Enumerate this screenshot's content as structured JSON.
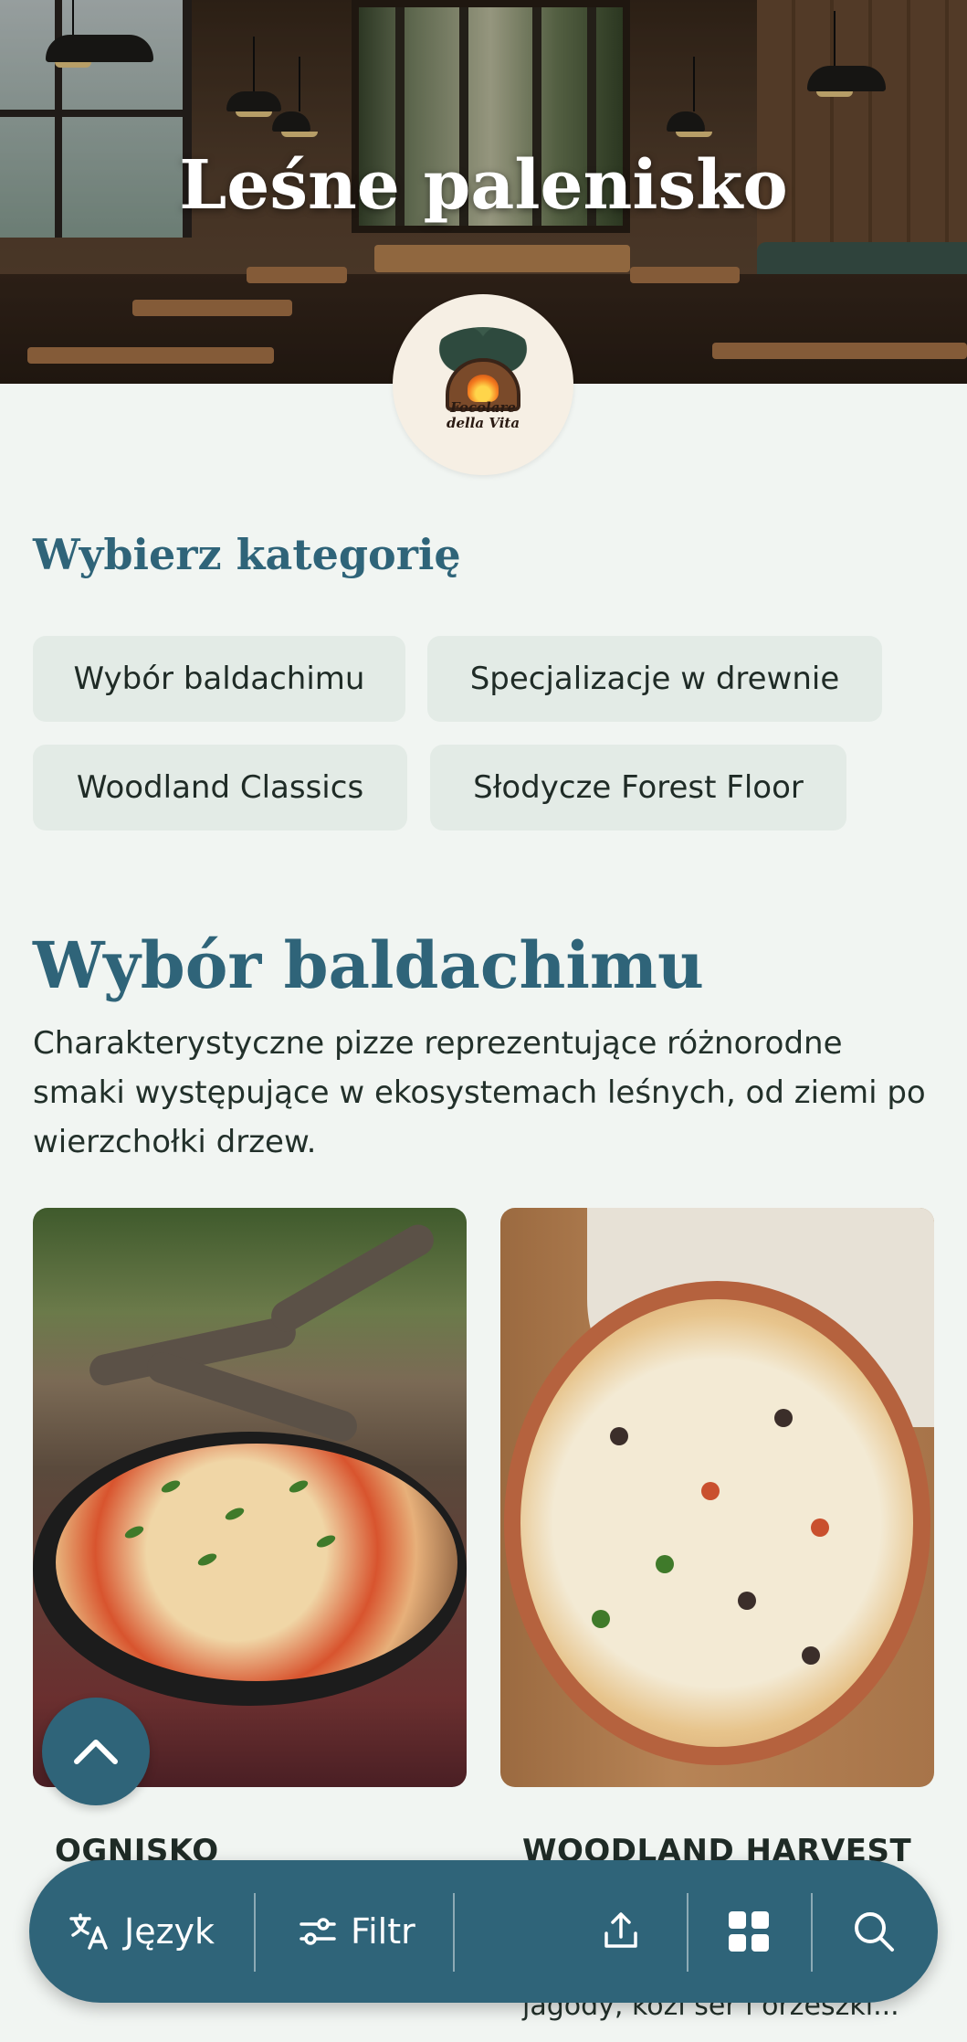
{
  "restaurant": {
    "title": "Leśne palenisko",
    "logo_text_line1": "Focolare",
    "logo_text_line2": "della Vita"
  },
  "categories_section": {
    "heading": "Wybierz kategorię",
    "chips": [
      "Wybór baldachimu",
      "Specjalizacje w drewnie",
      "Woodland Classics",
      "Słodycze Forest Floor"
    ]
  },
  "current_category": {
    "title": "Wybór baldachimu",
    "description": "Charakterystyczne pizze reprezentujące różnorodne smaki występujące w ekosystemach leśnych, od ziemi po wierzchołki drzew."
  },
  "products": [
    {
      "name": "OGNISKO",
      "description_partial": ""
    },
    {
      "name": "WOODLAND HARVEST",
      "description_partial": "jagody, kozi ser i orzeszki..."
    }
  ],
  "bottom_nav": {
    "language_label": "Język",
    "filter_label": "Filtr"
  },
  "icons": {
    "language": "translate-icon",
    "filter": "sliders-icon",
    "share": "share-icon",
    "grid": "grid-icon",
    "search": "search-icon",
    "scroll_top": "chevron-up-icon"
  },
  "colors": {
    "accent": "#2f6479",
    "background": "#f1f5f2",
    "chip_bg": "#e3ebe6",
    "text": "#1f2b26"
  }
}
